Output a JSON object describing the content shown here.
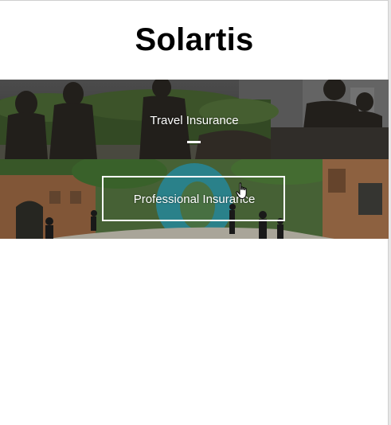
{
  "site": {
    "title": "Solartis"
  },
  "banners": [
    {
      "label": "Travel Insurance",
      "state": "default"
    },
    {
      "label": "Professional Insurance",
      "state": "hover"
    }
  ]
}
